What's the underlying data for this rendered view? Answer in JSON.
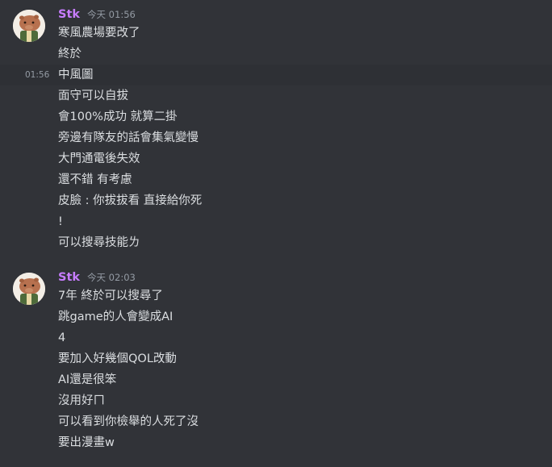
{
  "messages": [
    {
      "username": "Stk",
      "timestamp": "今天 01:56",
      "hover_time": "01:56",
      "lines": [
        "寒風農場要改了",
        "終於",
        "中風圖",
        "面守可以自拔",
        "會100%成功 就算二掛",
        "旁邊有隊友的話會集氣變慢",
        "大門通電後失效",
        "還不錯 有考慮",
        "皮臉 : 你拔拔看 直接給你死",
        "!",
        "可以搜尋技能ㄌ"
      ]
    },
    {
      "username": "Stk",
      "timestamp": "今天 02:03",
      "lines": [
        "7年 終於可以搜尋了",
        "跳game的人會變成AI",
        "4",
        "要加入好幾個QOL改動",
        "AI還是很笨",
        "沒用好ㄇ",
        "可以看到你檢舉的人死了沒",
        "要出漫畫w"
      ]
    }
  ],
  "colors": {
    "background": "#313338",
    "hover_background": "#2e3035",
    "username": "#c77dff",
    "message_text": "#dbdee1",
    "timestamp": "#949ba4"
  },
  "icons": {
    "avatar": "capybara-avatar-icon"
  }
}
